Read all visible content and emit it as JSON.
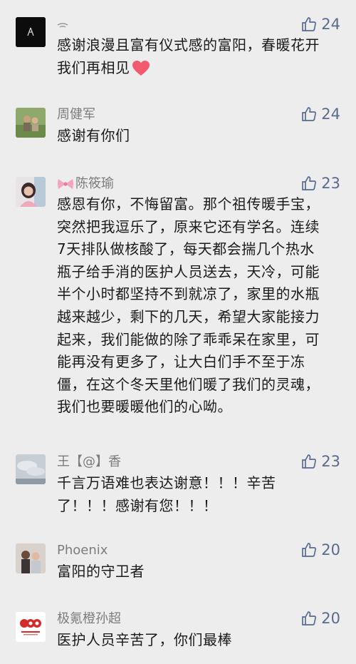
{
  "comments": [
    {
      "name": "",
      "likes": "24",
      "text": "感谢浪漫且富有仪式感的富阳，春暖花开我们再相见",
      "avatar_icon": "black-avatar-icon"
    },
    {
      "name": "周健军",
      "likes": "24",
      "text": "感谢有你们",
      "avatar_icon": "photo-avatar-icon"
    },
    {
      "name": "陈筱瑜",
      "likes": "23",
      "text": "感恩有你，不悔留富。那个祖传暖手宝，突然把我逗乐了，原来它还有学名。连续7天排队做核酸了，每天都会揣几个热水瓶子给手消的医护人员送去，天冷，可能半个小时都坚持不到就凉了，家里的水瓶越来越少，剩下的几天，希望大家能接力起来，我们能做的除了乖乖呆在家里，可能再没有更多了，让大白们手不至于冻僵，在这个冬天里他们暖了我们的灵魂，我们也要暖暖他们的心呦。",
      "avatar_icon": "photo-avatar-icon",
      "name_prefix_icon": "pink-bow-icon"
    },
    {
      "name": "王【@】香",
      "likes": "23",
      "text": "千言万语难也表达谢意！！！辛苦了！！！感谢有您！！！",
      "avatar_icon": "sky-avatar-icon"
    },
    {
      "name": "Phoenix",
      "likes": "20",
      "text": "富阳的守卫者",
      "avatar_icon": "photo-avatar-icon"
    },
    {
      "name": "极氪橙孙超",
      "likes": "20",
      "text": "医护人员辛苦了，你们最棒",
      "avatar_icon": "red-logo-avatar-icon"
    }
  ],
  "colors": {
    "background": "#ededed",
    "name": "#7c7c7c",
    "text": "#1a1a1a",
    "like": "#586b8e",
    "heart": "#f25a6e"
  }
}
